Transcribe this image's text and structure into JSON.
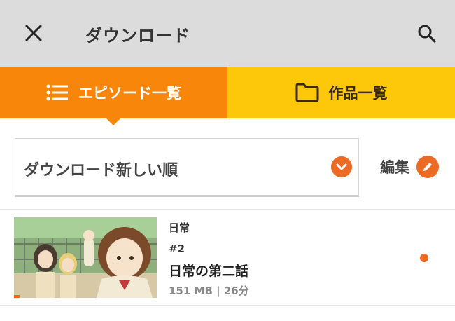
{
  "app_bar": {
    "title": "ダウンロード",
    "close_icon": "close-icon",
    "search_icon": "search-icon"
  },
  "tabs": [
    {
      "label": "エピソード一覧",
      "icon": "list-icon",
      "selected": true
    },
    {
      "label": "作品一覧",
      "icon": "folder-icon",
      "selected": false
    }
  ],
  "sort": {
    "selected": "ダウンロード新しい順",
    "icon": "chevron-down-icon"
  },
  "edit": {
    "label": "編集",
    "icon": "pencil-icon"
  },
  "episodes": [
    {
      "series": "日常",
      "number": "#2",
      "title": "日常の第二話",
      "meta": "151 MB | 26分",
      "unread": true
    }
  ],
  "colors": {
    "accent": "#ec6b24",
    "tab_active": "#f7860b",
    "tab_inactive": "#fdc80a",
    "app_bar": "#dcdcdc"
  }
}
